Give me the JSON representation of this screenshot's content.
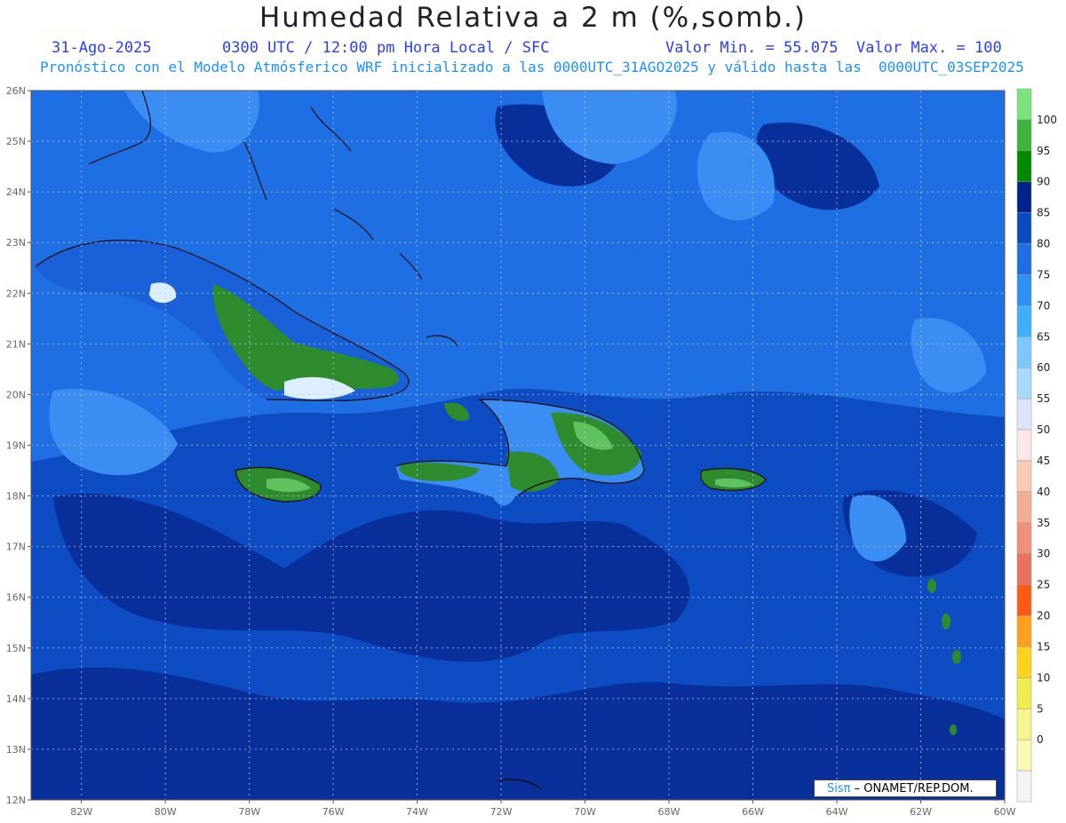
{
  "title": "Humedad Relativa a 2 m (%,somb.)",
  "header": {
    "date": "31-Ago-2025",
    "time": "0300 UTC / 12:00 pm Hora Local / SFC",
    "minmax": "Valor Min. = 55.075  Valor Max. = 100",
    "forecast": "Pronóstico con el Modelo Atmósferico WRF inicializado a las 0000UTC_31AGO2025 y válido hasta las  0000UTC_03SEP2025"
  },
  "axes": {
    "lat_labels": [
      "26N",
      "25N",
      "24N",
      "23N",
      "22N",
      "21N",
      "20N",
      "19N",
      "18N",
      "17N",
      "16N",
      "15N",
      "14N",
      "13N",
      "12N"
    ],
    "lon_labels": [
      "82W",
      "80W",
      "78W",
      "76W",
      "74W",
      "72W",
      "70W",
      "68W",
      "66W",
      "64W",
      "62W",
      "60W"
    ],
    "lat_range": [
      12,
      26
    ],
    "lon_range": [
      -83.2,
      -60
    ]
  },
  "legend": {
    "labels": [
      "100",
      "95",
      "90",
      "85",
      "80",
      "75",
      "70",
      "65",
      "60",
      "55",
      "50",
      "45",
      "40",
      "35",
      "30",
      "25",
      "20",
      "15",
      "10",
      "5",
      "0"
    ],
    "colors": [
      "#7be37b",
      "#3cb43c",
      "#008a00",
      "#00238c",
      "#0a4dc0",
      "#1e6ee6",
      "#2d90f5",
      "#3eb0fa",
      "#7cc8fa",
      "#a8d8fc",
      "#dce4fc",
      "#fde6e6",
      "#f8c9b4",
      "#f2ae92",
      "#ee907a",
      "#e8725e",
      "#ff5a14",
      "#ffa01e",
      "#ffd21e",
      "#f0ec50",
      "#f6f48c",
      "#fafab4",
      "#f4f4f4"
    ]
  },
  "credit": {
    "logo": "Sisπ",
    "text": "– ONAMET/REP.DOM."
  },
  "colors": {
    "ocean_deep": "#082f9a",
    "ocean": "#0e4cc4",
    "ocean_light": "#1f6fe4",
    "moist_high": "#2e8b2e",
    "moist_peak": "#5fc25f",
    "dry": "#6cb8f8",
    "driest": "#dceeff"
  }
}
